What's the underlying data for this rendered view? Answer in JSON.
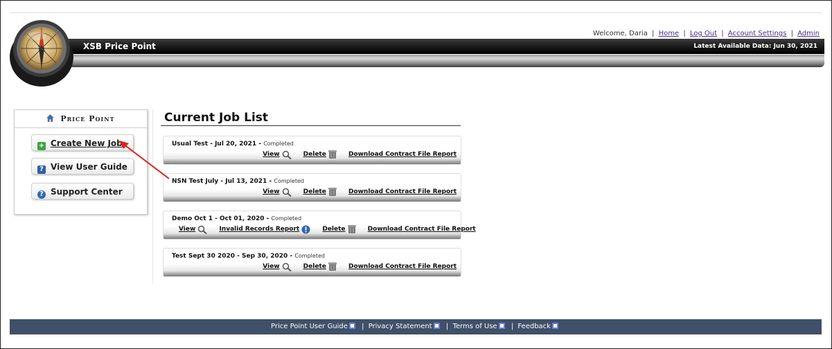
{
  "header": {
    "app_title": "XSB Price Point",
    "latest_data": "Latest Available Data: Jun 30, 2021",
    "welcome": "Welcome, Daria",
    "links": [
      "Home",
      "Log Out",
      "Account Settings",
      "Admin"
    ]
  },
  "sidebar": {
    "heading": "Price Point",
    "items": [
      {
        "label": "Create New Job",
        "icon": "plus-icon",
        "color": "#3ba33b"
      },
      {
        "label": "View User Guide",
        "icon": "guide-icon",
        "color": "#2e5ea8"
      },
      {
        "label": "Support Center",
        "icon": "help-icon",
        "color": "#2f67b7"
      }
    ]
  },
  "job_list": {
    "title": "Current Job List",
    "jobs": [
      {
        "name": "Usual Test - Jul 20, 2021",
        "status": "Completed",
        "view": "View",
        "delete": "Delete",
        "download": "Download Contract File Report"
      },
      {
        "name": "NSN Test July - Jul 13, 2021",
        "status": "Completed",
        "view": "View",
        "delete": "Delete",
        "download": "Download Contract File Report"
      },
      {
        "name": "Demo Oct 1 - Oct 01, 2020",
        "status": "Completed",
        "view": "View",
        "invalid": "Invalid Records Report",
        "delete": "Delete",
        "download": "Download Contract File Report"
      },
      {
        "name": "Test Sept 30 2020 - Sep 30, 2020",
        "status": "Completed",
        "view": "View",
        "delete": "Delete",
        "download": "Download Contract File Report"
      }
    ]
  },
  "footer": {
    "links": [
      "Price Point User Guide",
      "Privacy Statement",
      "Terms of Use",
      "Feedback"
    ]
  },
  "colors": {
    "banner": "#151515",
    "footer": "#3f5068",
    "link": "#4a2d8a",
    "annotation": "#e02020"
  }
}
